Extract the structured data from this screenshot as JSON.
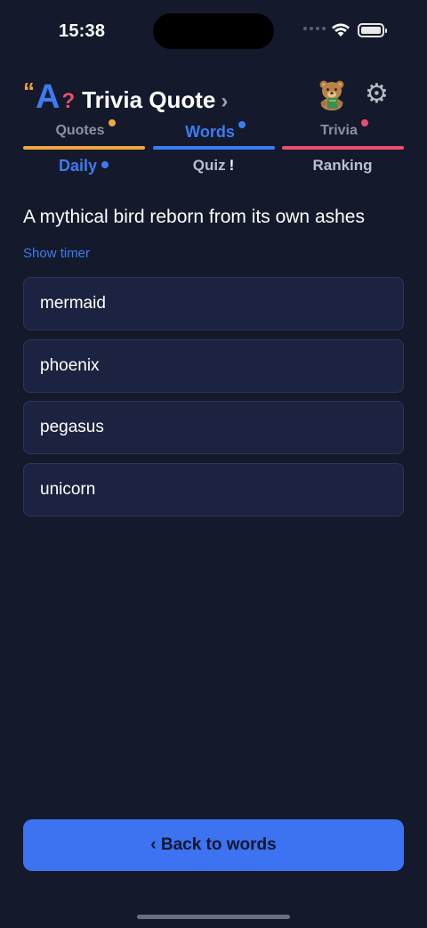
{
  "status_bar": {
    "time": "15:38"
  },
  "header": {
    "logo_quote": "“",
    "logo_letter": "A",
    "logo_question": "?",
    "title": "Trivia Quote",
    "chevron": "›",
    "mascot_icon": "bear-mascot-icon",
    "settings_icon": "gear-icon"
  },
  "category_tabs": [
    {
      "label": "Quotes",
      "color": "#f2a641",
      "text_color": "#8b92a5",
      "selected": false
    },
    {
      "label": "Words",
      "color": "#3d7bf0",
      "text_color": "#3d7bf0",
      "selected": true
    },
    {
      "label": "Trivia",
      "color": "#e8506e",
      "text_color": "#8b92a5",
      "selected": false
    }
  ],
  "sub_tabs": [
    {
      "label": "Daily",
      "selected": true,
      "badge": "dot"
    },
    {
      "label": "Quiz",
      "badge_text": "!"
    },
    {
      "label": "Ranking"
    }
  ],
  "question": {
    "text": "A mythical bird reborn from its own ashes",
    "timer_link": "Show timer"
  },
  "answers": [
    "mermaid",
    "phoenix",
    "pegasus",
    "unicorn"
  ],
  "footer": {
    "back_button": "‹ Back to words"
  },
  "colors": {
    "background": "#141a2c",
    "accent_blue": "#3d7bf0",
    "accent_orange": "#f2a641",
    "accent_pink": "#e8506e",
    "card": "#1c2340"
  }
}
